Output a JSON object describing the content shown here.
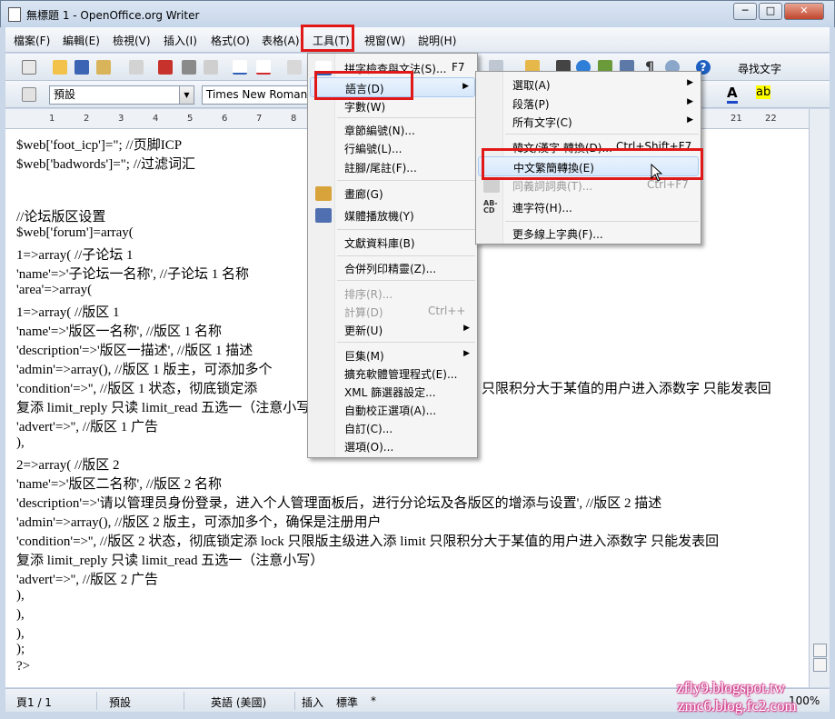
{
  "window": {
    "title": "無標題 1 - OpenOffice.org Writer",
    "btn_min": "─",
    "btn_max": "□",
    "btn_close": "✕"
  },
  "menubar": [
    "檔案(F)",
    "編輯(E)",
    "檢視(V)",
    "插入(I)",
    "格式(O)",
    "表格(A)",
    "工具(T)",
    "視窗(W)",
    "說明(H)"
  ],
  "toolbar": {
    "find_label": "尋找文字",
    "style_value": "預設",
    "font_value": "Times New Roman"
  },
  "ruler": [
    "1",
    "2",
    "3",
    "4",
    "5",
    "6",
    "7",
    "8",
    "21",
    "22"
  ],
  "document": {
    "lines": [
      "$web['foot_icp']=\";                    //页脚ICP",
      "$web['badwords']=\";  //过滤词汇",
      "",
      "",
      "//论坛版区设置",
      "$web['forum']=array(",
      "    1=>array( //子论坛 1",
      "      'name'=>'子论坛一名称', //子论坛 1 名称",
      "      'area'=>array(",
      "        1=>array( //版区 1",
      "          'name'=>'版区一名称', //版区 1 名称",
      "          'description'=>'版区一描述', //版区 1 描述",
      "          'admin'=>array(), //版区 1 版主，可添加多个",
      "          'condition'=>'', //版区 1 状态，彻底锁定添",
      "复添 limit_reply 只读 limit_read 五选一（注意小写",
      "          'advert'=>'', //版区 1 广告",
      "        ),",
      "        2=>array( //版区 2",
      "          'name'=>'版区二名称', //版区 2 名称",
      "          'description'=>'请以管理员身份登录，进入个人管理面板后，进行分论坛及各版区的增添与设置', //版区 2 描述",
      "          'admin'=>array(), //版区 2 版主，可添加多个，确保是注册用户",
      "          'condition'=>'', //版区 2 状态，彻底锁定添 lock 只限版主级进入添 limit 只限积分大于某值的用户进入添数字 只能发表回",
      "复添 limit_reply 只读 limit_read 五选一（注意小写）",
      "          'advert'=>'', //版区 2 广告",
      "        ),",
      "      ),",
      "    ),",
      ");",
      "?>"
    ],
    "line13_tail": "只限积分大于某值的用户进入添数字 只能发表回"
  },
  "tools_menu": [
    {
      "label": "拼字檢查與文法(S)...",
      "shortcut": "F7",
      "icon": "spellcheck-icon"
    },
    {
      "label": "語言(D)",
      "submenu": true
    },
    {
      "label": "字數(W)"
    },
    {
      "label": "章節編號(N)..."
    },
    {
      "label": "行編號(L)..."
    },
    {
      "label": "註腳/尾註(F)..."
    },
    {
      "label": "畫廊(G)",
      "icon": "gallery-icon"
    },
    {
      "label": "媒體播放機(Y)",
      "icon": "media-player-icon"
    },
    {
      "label": "文獻資料庫(B)"
    },
    {
      "label": "合併列印精靈(Z)..."
    },
    {
      "label": "排序(R)...",
      "disabled": true
    },
    {
      "label": "計算(D)",
      "shortcut": "Ctrl++",
      "disabled": true
    },
    {
      "label": "更新(U)",
      "submenu": true
    },
    {
      "label": "巨集(M)",
      "submenu": true
    },
    {
      "label": "擴充軟體管理程式(E)..."
    },
    {
      "label": "XML 篩選器設定..."
    },
    {
      "label": "自動校正選項(A)..."
    },
    {
      "label": "自訂(C)..."
    },
    {
      "label": "選項(O)..."
    }
  ],
  "language_menu": [
    {
      "label": "選取(A)",
      "submenu": true
    },
    {
      "label": "段落(P)",
      "submenu": true
    },
    {
      "label": "所有文字(C)",
      "submenu": true
    },
    {
      "label": "韓文/漢字 轉換(D)...",
      "shortcut": "Ctrl+Shift+F7"
    },
    {
      "label": "中文繁簡轉換(E)",
      "highlighted": true
    },
    {
      "label": "同義詞詞典(T)...",
      "shortcut": "Ctrl+F7",
      "disabled": true,
      "icon": "thesaurus-icon"
    },
    {
      "label": "連字符(H)...",
      "icon": "hyphenation-icon"
    },
    {
      "label": "更多線上字典(F)..."
    }
  ],
  "statusbar": {
    "page": "頁1 / 1",
    "style": "預設",
    "lang": "英語 (美國)",
    "mode": "插入",
    "sel": "標準",
    "mod": "*",
    "zoom": "100%"
  },
  "watermark": {
    "line1": "zfly9.blogspot.tw",
    "line2": "zmc6.blog.fc2.com"
  },
  "colors": {
    "highlight_box": "#e01818",
    "menu_hover": "#d6e7fb"
  }
}
